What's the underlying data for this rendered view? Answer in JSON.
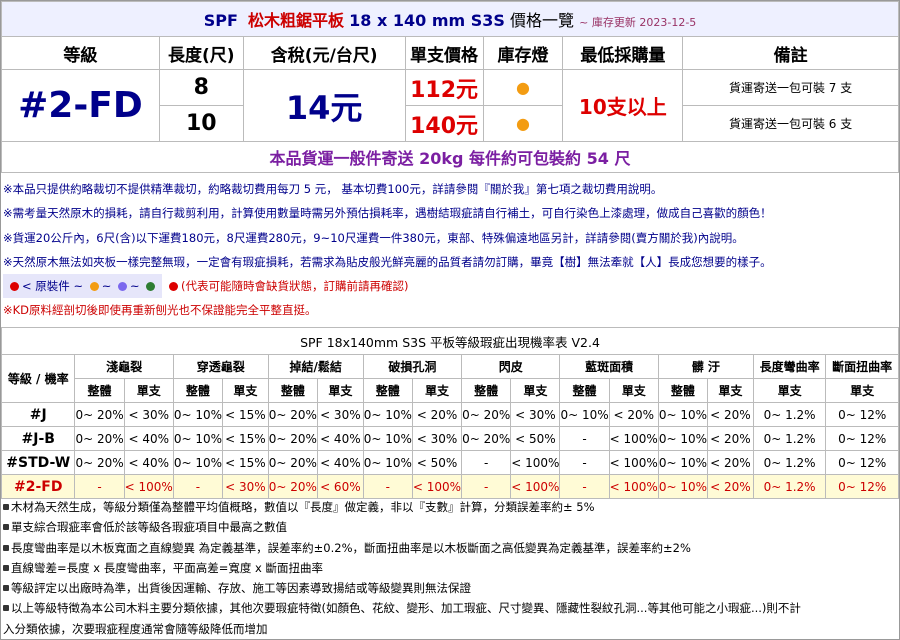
{
  "header": {
    "spf": "SPF",
    "product": "松木粗鋸平板",
    "spec": "18 x 140 mm S3S",
    "suffix": "價格一覽",
    "updated": "~ 庫存更新 2023-12-5"
  },
  "columns": {
    "grade": "等級",
    "length": "長度(尺)",
    "price_tax": "含稅(元/台尺)",
    "unit_price": "單支價格",
    "stock": "庫存燈",
    "min_qty": "最低採購量",
    "remark": "備註"
  },
  "product": {
    "grade": "#2-FD",
    "price": "14元",
    "min_qty": "10支以上",
    "rows": [
      {
        "length": "8",
        "unit_price": "112元",
        "stock": "●",
        "remark": "貨運寄送一包可裝 7 支"
      },
      {
        "length": "10",
        "unit_price": "140元",
        "stock": "●",
        "remark": "貨運寄送一包可裝 6 支"
      }
    ]
  },
  "shipping": "本品貨運一般件寄送 20kg 每件約可包裝約 54 尺",
  "notes": [
    "※本品只提供約略裁切不提供精準裁切，約略裁切費用每刀 5 元， 基本切費100元，詳請參閱『關於我』第七項之裁切費用說明。",
    "※需考量天然原木的損耗，請自行裁剪利用，計算使用數量時需另外預估損耗率，遇樹結瑕疵請自行補土，可自行染色上漆處理，做成自己喜歡的顏色！",
    "※貨運20公斤內，6尺(含)以下運費180元，8尺運費280元，9~10尺運費一件380元，東部、特殊偏遠地區另計，詳請參閱(賣方關於我)內說明。",
    "※天然原木無法如夾板一樣完整無瑕，一定會有瑕疵損耗，若需求為貼皮般光鮮亮麗的品質者請勿訂購，畢竟【樹】無法牽就【人】長成您想要的樣子。"
  ],
  "legend": {
    "label": "< 原裝件 ~",
    "tilde": "~",
    "warning": "(代表可能隨時會缺貨狀態，訂購前請再確認)",
    "colors": [
      "#dd0000",
      "#f39c12",
      "#7b68ee",
      "#2e7d32"
    ]
  },
  "kd_note": "※KD原料經剖切後即使再重新刨光也不保證能完全平整直挺。",
  "defect_table": {
    "caption": "SPF 18x140mm S3S 平板等級瑕疵出現機率表 V2.4",
    "corner": "等級 / 機率",
    "groups": [
      "淺龜裂",
      "穿透龜裂",
      "掉結/鬆結",
      "破損孔洞",
      "閃皮",
      "藍斑面積",
      "髒 汙",
      "長度彎曲率",
      "斷面扭曲率"
    ],
    "sub_whole": "整體",
    "sub_single": "單支",
    "rows": [
      {
        "grade": "#J",
        "values": [
          "0~ 20%",
          "< 30%",
          "0~ 10%",
          "< 15%",
          "0~ 20%",
          "< 30%",
          "0~ 10%",
          "< 20%",
          "0~ 20%",
          "< 30%",
          "0~ 10%",
          "< 20%",
          "0~ 10%",
          "< 20%",
          "0~ 1.2%",
          "0~ 12%"
        ]
      },
      {
        "grade": "#J-B",
        "values": [
          "0~ 20%",
          "< 40%",
          "0~ 10%",
          "< 15%",
          "0~ 20%",
          "< 40%",
          "0~ 10%",
          "< 30%",
          "0~ 20%",
          "< 50%",
          "-",
          "< 100%",
          "0~ 10%",
          "< 20%",
          "0~ 1.2%",
          "0~ 12%"
        ]
      },
      {
        "grade": "#STD-W",
        "values": [
          "0~ 20%",
          "< 40%",
          "0~ 10%",
          "< 15%",
          "0~ 20%",
          "< 40%",
          "0~ 10%",
          "< 50%",
          "-",
          "< 100%",
          "-",
          "< 100%",
          "0~ 10%",
          "< 20%",
          "0~ 1.2%",
          "0~ 12%"
        ]
      },
      {
        "grade": "#2-FD",
        "values": [
          "-",
          "< 100%",
          "-",
          "< 30%",
          "0~ 20%",
          "< 60%",
          "-",
          "< 100%",
          "-",
          "< 100%",
          "-",
          "< 100%",
          "0~ 10%",
          "< 20%",
          "0~ 1.2%",
          "0~ 12%"
        ]
      }
    ]
  },
  "footnotes": [
    "木材為天然生成，等級分類僅為整體平均值概略，數值以『長度』做定義，非以『支數』計算，分類誤差率約± 5%",
    "單支綜合瑕疵率會低於該等級各瑕疵項目中最高之數值",
    "長度彎曲率是以木板寬面之直線變異 為定義基準，誤差率約±0.2%，斷面扭曲率是以木板斷面之高低變異為定義基準，誤差率約±2%",
    "直線彎差=長度 x 長度彎曲率，平面高差=寬度 x 斷面扭曲率",
    "等級評定以出廠時為準，出貨後因運輸、存放、施工等因素導致揚結或等級變異則無法保證",
    "以上等級特徵為本公司木料主要分類依據，其他次要瑕疵特徵(如顏色、花紋、變形、加工瑕疵、尺寸變異、隱藏性裂紋孔洞...等其他可能之小瑕疵...)則不計",
    "入分類依據，次要瑕疵程度通常會隨等級降低而增加"
  ]
}
